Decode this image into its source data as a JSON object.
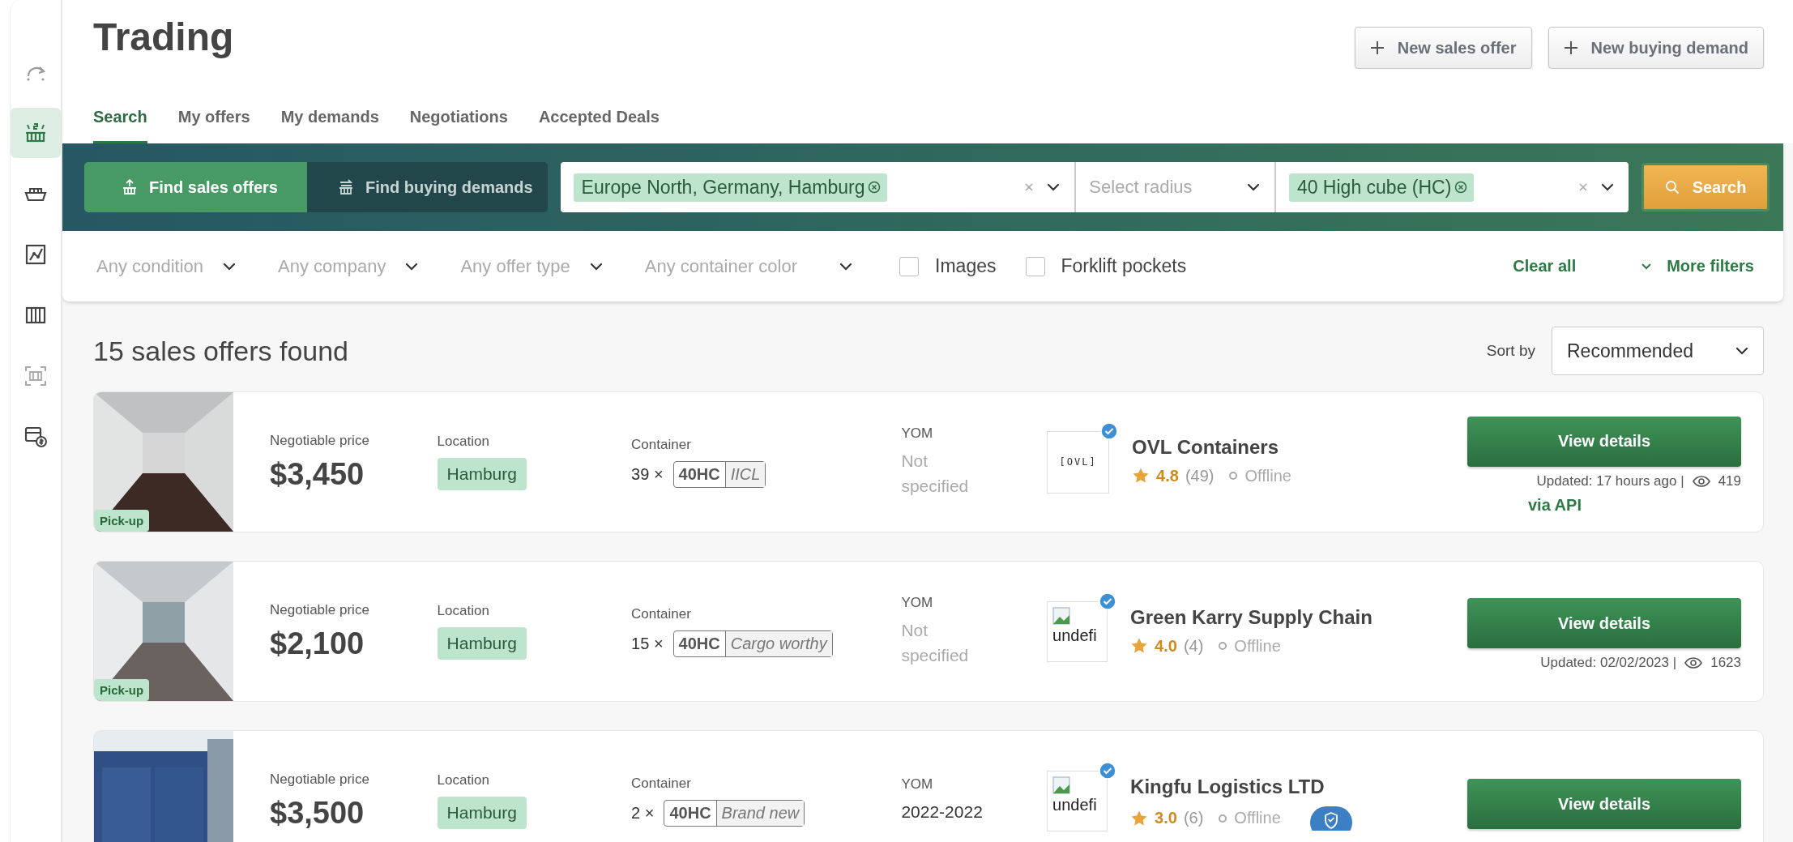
{
  "sidebar": {
    "items": [
      {
        "selected": false
      },
      {
        "selected": true
      },
      {
        "selected": false
      },
      {
        "selected": false
      },
      {
        "selected": false
      },
      {
        "selected": false
      },
      {
        "selected": false
      }
    ]
  },
  "page": {
    "title": "Trading",
    "actions": [
      {
        "label": "New sales offer"
      },
      {
        "label": "New buying demand"
      }
    ]
  },
  "tabs": [
    {
      "label": "Search",
      "selected": true
    },
    {
      "label": "My offers",
      "selected": false
    },
    {
      "label": "My demands",
      "selected": false
    },
    {
      "label": "Negotiations",
      "selected": false
    },
    {
      "label": "Accepted Deals",
      "selected": false
    }
  ],
  "search_bar": {
    "modes": [
      {
        "label": "Find sales offers",
        "selected": true
      },
      {
        "label": "Find buying demands",
        "selected": false
      }
    ],
    "location": {
      "chips": [
        "Europe North, Germany, Hamburg"
      ]
    },
    "radius": {
      "placeholder": "Select radius"
    },
    "container_type": {
      "chips": [
        "40 High cube (HC)"
      ]
    },
    "button": "Search"
  },
  "filters": {
    "dropdowns": [
      {
        "placeholder": "Any condition"
      },
      {
        "placeholder": "Any company"
      },
      {
        "placeholder": "Any offer type"
      },
      {
        "placeholder": "Any container color"
      }
    ],
    "checkboxes": [
      {
        "label": "Images",
        "checked": false
      },
      {
        "label": "Forklift pockets",
        "checked": false
      }
    ],
    "clear": "Clear all",
    "more": "More filters"
  },
  "results": {
    "count": "15 sales offers found",
    "sort_label": "Sort by",
    "sort_value": "Recommended"
  },
  "offers": [
    {
      "pickup": "Pick-up",
      "price_label": "Negotiable price",
      "price": "$3,450",
      "location_label": "Location",
      "location": "Hamburg",
      "container_label": "Container",
      "quantity": "39 ×",
      "type": "40HC",
      "condition": "IICL",
      "yom_label": "YOM",
      "yom": "Not specified",
      "yom_specified": false,
      "logo": {
        "kind": "text",
        "text": "[OVL]"
      },
      "verified": true,
      "company": "OVL Containers",
      "rating": "4.8",
      "reviews": "(49)",
      "status": "Offline",
      "protected": false,
      "button": "View details",
      "updated": "Updated: 17 hours ago |",
      "views": "419",
      "via": "via API"
    },
    {
      "pickup": "Pick-up",
      "price_label": "Negotiable price",
      "price": "$2,100",
      "location_label": "Location",
      "location": "Hamburg",
      "container_label": "Container",
      "quantity": "15 ×",
      "type": "40HC",
      "condition": "Cargo worthy",
      "yom_label": "YOM",
      "yom": "Not specified",
      "yom_specified": false,
      "logo": {
        "kind": "broken",
        "text": "undefi"
      },
      "verified": true,
      "company": "Green Karry Supply Chain",
      "rating": "4.0",
      "reviews": "(4)",
      "status": "Offline",
      "protected": false,
      "button": "View details",
      "updated": "Updated: 02/02/2023 |",
      "views": "1623"
    },
    {
      "price_label": "Negotiable price",
      "price": "$3,500",
      "location_label": "Location",
      "location": "Hamburg",
      "container_label": "Container",
      "quantity": "2 ×",
      "type": "40HC",
      "condition": "Brand new",
      "yom_label": "YOM",
      "yom": "2022-2022",
      "yom_specified": true,
      "logo": {
        "kind": "broken",
        "text": "undefi"
      },
      "verified": true,
      "company": "Kingfu Logistics LTD",
      "rating": "3.0",
      "reviews": "(6)",
      "status": "Offline",
      "protected": true,
      "button": "View details"
    }
  ]
}
